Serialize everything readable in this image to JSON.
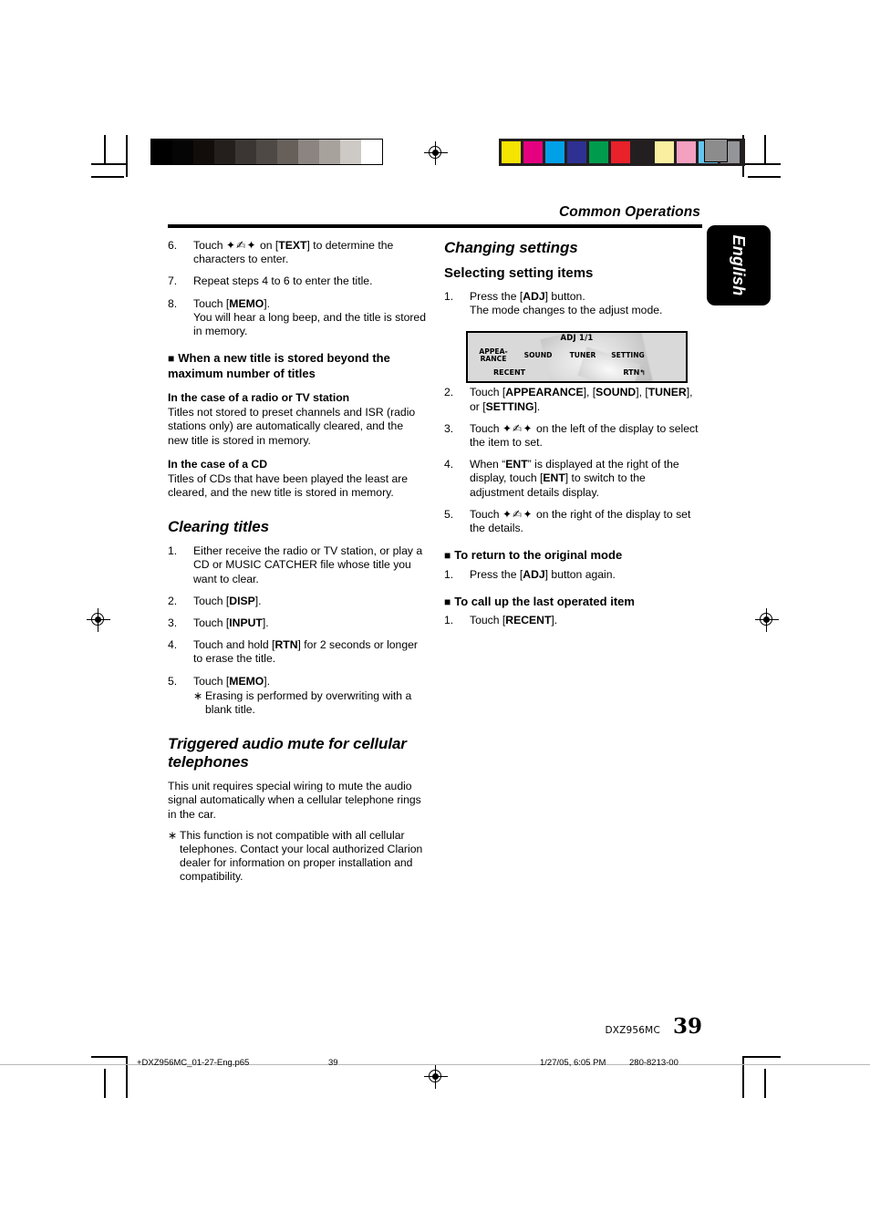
{
  "header": {
    "title": "Common Operations",
    "language_tab": "English"
  },
  "left_column": {
    "continued_steps": [
      {
        "num": "6.",
        "text": "Touch ",
        "glyph": "✦✍✦",
        "text2": " on [TEXT] to determine the characters to enter."
      },
      {
        "num": "7.",
        "text": "Repeat steps 4 to 6 to enter the title."
      },
      {
        "num": "8.",
        "text": "Touch [MEMO].",
        "sub": "You will hear a long beep, and the title is stored in memory."
      }
    ],
    "block_heading": "When a new title is stored beyond the maximum number of titles",
    "case_radio": {
      "heading": "In the case of a radio or TV station",
      "body": "Titles not stored to preset channels and ISR (radio stations only) are automatically cleared, and the new title is stored in memory."
    },
    "case_cd": {
      "heading": "In the case of a CD",
      "body": "Titles of CDs that have been played the least are cleared, and the new title is stored in memory."
    },
    "clearing_titles": {
      "heading": "Clearing titles",
      "steps": [
        {
          "num": "1.",
          "text": "Either receive the radio or TV station, or play a CD or MUSIC CATCHER file whose title you want to clear."
        },
        {
          "num": "2.",
          "text": "Touch [DISP]."
        },
        {
          "num": "3.",
          "text": "Touch [INPUT]."
        },
        {
          "num": "4.",
          "text": "Touch and hold [RTN] for 2 seconds or longer to erase the title."
        },
        {
          "num": "5.",
          "text": "Touch [MEMO].",
          "note": "Erasing is performed by overwriting with a blank title."
        }
      ]
    },
    "triggered_mute": {
      "heading": "Triggered audio mute for cellular telephones",
      "body": "This unit requires special wiring to mute the audio signal automatically when a cellular telephone rings in the car.",
      "note": "This function is not compatible with all cellular telephones. Contact your local authorized Clarion dealer for information on proper installation and compatibility."
    }
  },
  "right_column": {
    "changing_settings": "Changing settings",
    "selecting_setting_items": "Selecting setting items",
    "step1": {
      "num": "1.",
      "text": "Press the [ADJ] button.",
      "sub": "The mode changes to the adjust mode."
    },
    "lcd": {
      "title": "ADJ 1/1",
      "buttons": [
        "APPEA-RANCE",
        "SOUND",
        "TUNER",
        "SETTING"
      ],
      "button_lines": [
        [
          "APPEA-",
          "RANCE"
        ],
        [
          "SOUND"
        ],
        [
          "TUNER"
        ],
        [
          "SETTING"
        ]
      ],
      "recent_label": "RECENT",
      "rtn_label": "RTN",
      "rtn_glyph": "↰"
    },
    "steps": [
      {
        "num": "2.",
        "text": "Touch [APPEARANCE], [SOUND], [TUNER], or [SETTING]."
      },
      {
        "num": "3.",
        "text": "Touch ",
        "glyph": "✦✍✦",
        "text2": " on the left of the display to select the item to set."
      },
      {
        "num": "4.",
        "text": "When “ENT” is displayed at the right of the display, touch [ENT] to switch to the adjustment details display."
      },
      {
        "num": "5.",
        "text": "Touch ",
        "glyph": "✦✍✦",
        "text2": " on the right of the display to set the details."
      }
    ],
    "return_block": {
      "heading": "To return to the original mode",
      "step": {
        "num": "1.",
        "text": "Press the [ADJ] button again."
      }
    },
    "recall_block": {
      "heading": "To call up the last operated item",
      "step": {
        "num": "1.",
        "text": "Touch [RECENT]."
      }
    }
  },
  "footer": {
    "model": "DXZ956MC",
    "page_number": "39",
    "print_file": "+DXZ956MC_01-27-Eng.p65",
    "print_page": "39",
    "print_date": "1/27/05, 6:05 PM",
    "print_code": "280-8213-00"
  },
  "calibration": {
    "gray_steps": [
      "#000000",
      "#050505",
      "#120d0b",
      "#241f1d",
      "#3b3633",
      "#4f4945",
      "#665f5a",
      "#8b8480",
      "#a8a29d",
      "#cdc9c5",
      "#ffffff"
    ],
    "color_patches": [
      "#f5e300",
      "#e4007f",
      "#00a0e9",
      "#2e3192",
      "#009b4c",
      "#e8212a",
      "#231f20",
      "#faeea0",
      "#f4a0c0",
      "#62c6f0",
      "#939598"
    ],
    "gray_square": "#8c8c8c"
  }
}
